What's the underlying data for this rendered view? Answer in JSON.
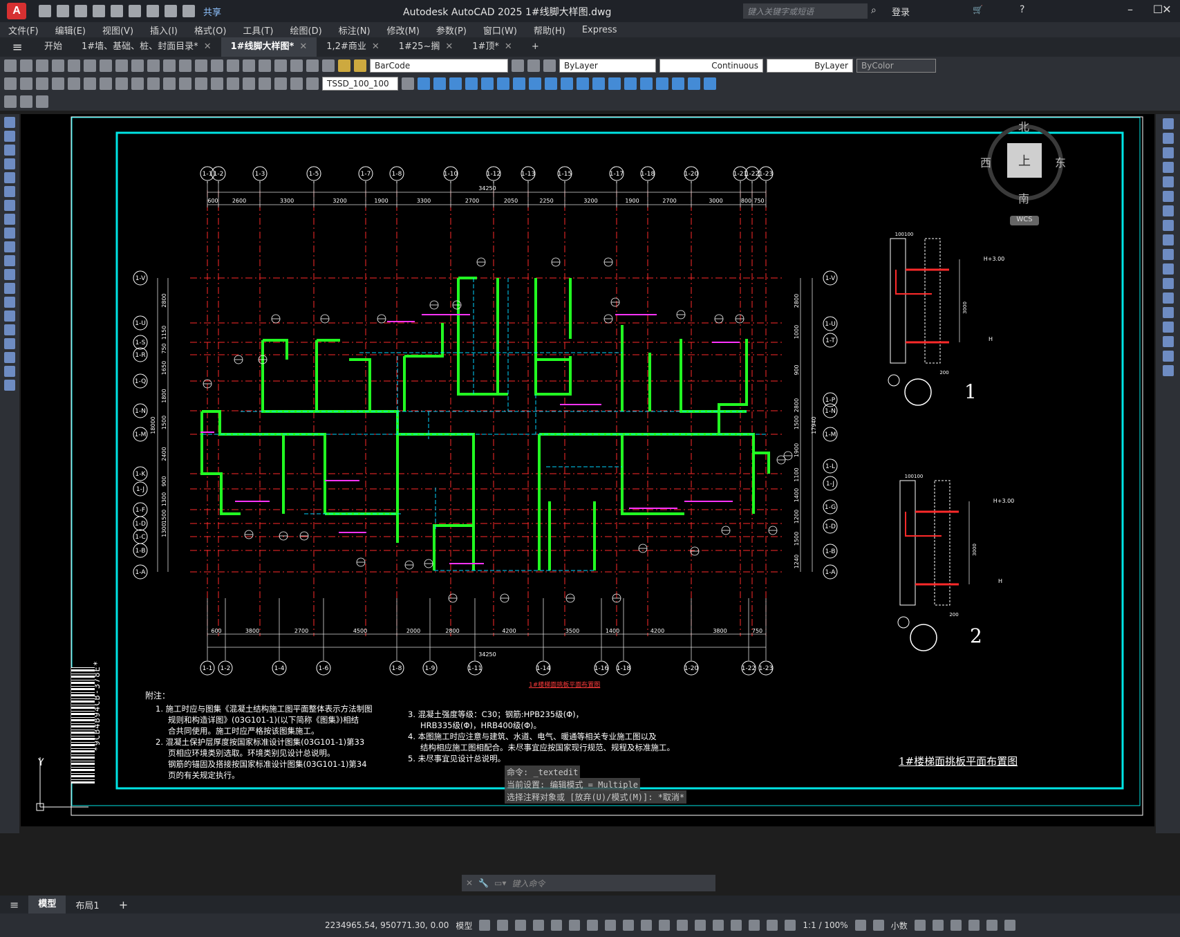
{
  "app": {
    "logo": "A",
    "title": "Autodesk AutoCAD 2025    1#线脚大样图.dwg",
    "share": "共享",
    "search_placeholder": "键入关键字或短语",
    "login": "登录"
  },
  "menu": [
    "文件(F)",
    "编辑(E)",
    "视图(V)",
    "插入(I)",
    "格式(O)",
    "工具(T)",
    "绘图(D)",
    "标注(N)",
    "修改(M)",
    "参数(P)",
    "窗口(W)",
    "帮助(H)",
    "Express"
  ],
  "tabs": [
    {
      "label": "开始",
      "active": false
    },
    {
      "label": "1#墙、基础、桩、封面目录*",
      "active": false
    },
    {
      "label": "1#线脚大样图*",
      "active": true
    },
    {
      "label": "1,2#商业",
      "active": false
    },
    {
      "label": "1#25~搁",
      "active": false
    },
    {
      "label": "1#顶*",
      "active": false
    }
  ],
  "toolbar": {
    "barcode": "BarCode",
    "layer": "ByLayer",
    "linetype": "Continuous",
    "lineweight": "ByLayer",
    "color": "ByColor",
    "dimstyle": "TSSD_100_100"
  },
  "viewcube": {
    "north": "北",
    "south": "南",
    "east": "东",
    "west": "西",
    "top": "上",
    "wcs": "WCS"
  },
  "drawing": {
    "top_axes": [
      "1-1",
      "1-2",
      "1-3",
      "1-5",
      "1-7",
      "1-8",
      "1-10",
      "1-12",
      "1-13",
      "1-15",
      "1-17",
      "1-18",
      "1-20",
      "1-21",
      "1-22",
      "1-23"
    ],
    "bottom_axes": [
      "1-1",
      "1-2",
      "1-4",
      "1-6",
      "1-8",
      "1-9",
      "1-11",
      "1-14",
      "1-16",
      "1-18",
      "1-20",
      "1-22",
      "1-23"
    ],
    "left_axes": [
      "1-V",
      "1-U",
      "1-S",
      "1-R",
      "1-Q",
      "1-N",
      "1-M",
      "1-K",
      "1-J",
      "1-F",
      "1-D",
      "1-C",
      "1-B",
      "1-A"
    ],
    "right_axes": [
      "1-V",
      "1-U",
      "1-T",
      "1-P",
      "1-N",
      "1-M",
      "1-L",
      "1-J",
      "1-G",
      "1-D",
      "1-B",
      "1-A"
    ],
    "top_total": "34250",
    "top_dims": [
      "600",
      "2600",
      "3300",
      "3200",
      "1900",
      "3300",
      "2700",
      "2050",
      "2250",
      "3200",
      "1900",
      "2700",
      "3000",
      "800",
      "750"
    ],
    "bottom_total": "34250",
    "bottom_dims": [
      "600",
      "3800",
      "2700",
      "4500",
      "2000",
      "2800",
      "4200",
      "3500",
      "1400",
      "4200",
      "3800",
      "750"
    ],
    "left_total": "18000",
    "left_dims": [
      "2800",
      "1150",
      "750",
      "1650",
      "1800",
      "1500",
      "2400",
      "900",
      "1300",
      "1500",
      "1300"
    ],
    "right_total": "17940",
    "right_dims": [
      "2800",
      "1000",
      "900",
      "2800",
      "1500",
      "1900",
      "1100",
      "1400",
      "1200",
      "1500",
      "1240"
    ],
    "plan_title": "1#楼梯面挑板平面布置图",
    "drawing_title": "1#楼梯面挑板平面布置图",
    "notes_title": "附注：",
    "notes_left": [
      "1. 施工时应与图集《混凝土结构施工图平面整体表示方法制图",
      "规则和构造详图》(03G101-1)(以下简称《图集》)相结",
      "合共同使用。施工时应严格按该图集施工。",
      "2. 混凝土保护层厚度按国家标准设计图集(03G101-1)第33",
      "页相应环境类别选取。环境类别见设计总说明。",
      "钢筋的锚固及搭接按国家标准设计图集(03G101-1)第34",
      "页的有关规定执行。"
    ],
    "notes_right": [
      "3. 混凝土强度等级：C30；钢筋:HPB235级(Φ)，",
      "HRB335级(Φ)，HRB400级(Φ)。",
      "4. 本图施工时应注意与建筑、水道、电气、暖通等相关专业施工图以及",
      "结构相应施工图相配合。未尽事宜应按国家现行规范、规程及标准施工。",
      "5. 未尽事宜见设计总说明。"
    ],
    "section1": "1",
    "section2": "2",
    "sec_labels": [
      "H+3.00",
      "H",
      "3000",
      "100100",
      "200"
    ],
    "barcode_text": "*9CB4B94CB-378E*"
  },
  "command": {
    "line1": "命令:  _textedit",
    "line2": "当前设置: 编辑模式 = Multiple",
    "line3": "选择注释对象或 [放弃(U)/模式(M)]: *取消*",
    "placeholder": "键入命令"
  },
  "layout_tabs": [
    "模型",
    "布局1"
  ],
  "status": {
    "coords": "2234965.54, 950771.30, 0.00",
    "model": "模型",
    "scale": "1:1 / 100%",
    "units": "小数"
  }
}
